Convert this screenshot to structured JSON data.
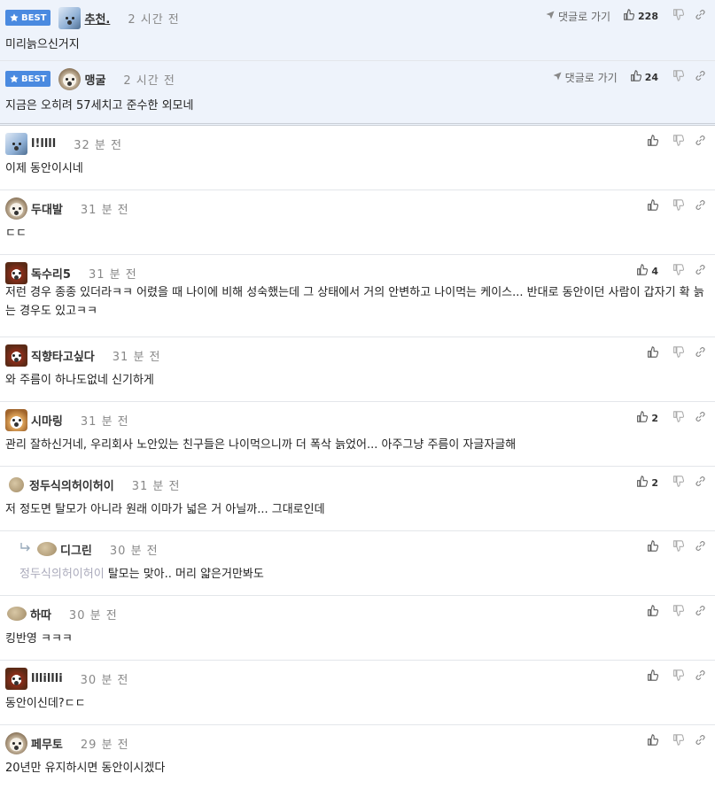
{
  "comments": [
    {
      "best": true,
      "badge": "BEST",
      "avatar": "bear-avatar",
      "nick": "추천.",
      "time": "2 시간 전",
      "reply_label": "댓글로 가기",
      "likes": "228",
      "text": "미리늙으신거지"
    },
    {
      "best": true,
      "badge": "BEST",
      "avatar": "dog-avatar",
      "nick": "맹굴",
      "time": "2 시간 전",
      "reply_label": "댓글로 가기",
      "likes": "24",
      "text": "지금은 오히려 57세치고 준수한 외모네"
    },
    {
      "avatar": "bear-avatar",
      "nick": "l!llll",
      "time": "32 분 전",
      "likes": "",
      "text": "이제 동안이시네"
    },
    {
      "avatar": "dog-avatar",
      "nick": "두대발",
      "time": "31 분 전",
      "likes": "",
      "text": "ㄷㄷ"
    },
    {
      "avatar": "lion-avatar",
      "nick": "독수리5",
      "time": "31 분 전",
      "likes": "4",
      "text": "저런 경우 종종 있더라ㅋㅋ 어렸을 때 나이에 비해 성숙했는데 그 상태에서 거의 안변하고 나이먹는 케이스... 반대로 동안이던 사람이 갑자기 확 늙는 경우도 있고ㅋㅋ"
    },
    {
      "avatar": "lion-avatar",
      "nick": "직향타고싶다",
      "time": "31 분 전",
      "likes": "",
      "text": "와 주름이 하나도없네 신기하게"
    },
    {
      "avatar": "fox-avatar",
      "nick": "시마링",
      "time": "31 분 전",
      "likes": "2",
      "text": "관리 잘하신거네, 우리회사 노안있는 친구들은 나이먹으니까 더 폭삭 늙었어... 아주그냥 주름이 자글자글해"
    },
    {
      "avatar": "blob-avatar",
      "nick": "정두식의허이허이",
      "time": "31 분 전",
      "likes": "2",
      "text": "저 정도면 탈모가 아니라 원래 이마가 넓은 거 아닐까... 그대로인데"
    },
    {
      "reply": true,
      "avatar": "blob-avatar",
      "nick": "디그린",
      "time": "30 분 전",
      "likes": "",
      "mention": "정두식의허이허이",
      "text": "탈모는 맞아.. 머리 얇은거만봐도"
    },
    {
      "avatar": "blob-avatar",
      "nick": "하따",
      "time": "30 분 전",
      "likes": "",
      "text": "킹반영 ㅋㅋㅋ"
    },
    {
      "avatar": "lion-avatar",
      "nick": "lllillli",
      "time": "30 분 전",
      "likes": "",
      "text": "동안이신데?ㄷㄷ"
    },
    {
      "avatar": "dog-avatar",
      "nick": "페무토",
      "time": "29 분 전",
      "likes": "",
      "text": "20년만 유지하시면 동안이시겠다"
    }
  ],
  "colors": {
    "best_bg": "#eef3fb",
    "badge": "#4a8ae0",
    "time": "#888888",
    "mention": "#aaaabb"
  }
}
